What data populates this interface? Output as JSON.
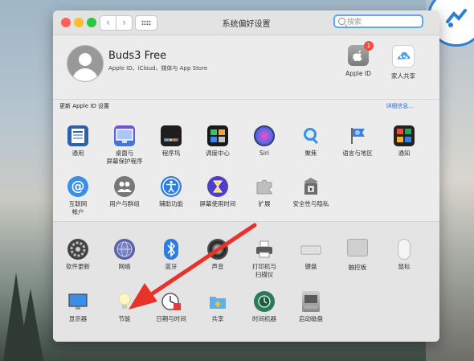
{
  "window": {
    "title": "系统偏好设置",
    "search_placeholder": "搜索",
    "nav_back": "‹",
    "nav_forward": "›"
  },
  "user": {
    "name": "Buds3 Free",
    "subtitle": "Apple ID、iCloud、媒体与 App Store"
  },
  "top_items": [
    {
      "label": "Apple ID",
      "icon": "apple-id-icon",
      "badge": "1"
    },
    {
      "label": "家人共享",
      "icon": "family-sharing-icon"
    }
  ],
  "notice": {
    "text": "更新 Apple ID 设置",
    "link": "详细信息..."
  },
  "row1": [
    {
      "label": "通用",
      "icon": "general-icon"
    },
    {
      "label": "桌面与\n屏幕保护程序",
      "icon": "desktop-icon"
    },
    {
      "label": "程序坞",
      "icon": "dock-icon"
    },
    {
      "label": "调度中心",
      "icon": "mission-control-icon"
    },
    {
      "label": "Siri",
      "icon": "siri-icon"
    },
    {
      "label": "聚焦",
      "icon": "spotlight-icon"
    },
    {
      "label": "语言与地区",
      "icon": "language-icon"
    },
    {
      "label": "通知",
      "icon": "notifications-icon"
    }
  ],
  "row2": [
    {
      "label": "互联网\n帐户",
      "icon": "internet-accounts-icon"
    },
    {
      "label": "用户与群组",
      "icon": "users-icon"
    },
    {
      "label": "辅助功能",
      "icon": "accessibility-icon"
    },
    {
      "label": "屏幕使用时间",
      "icon": "screen-time-icon"
    },
    {
      "label": "扩展",
      "icon": "extensions-icon"
    },
    {
      "label": "安全性与隐私",
      "icon": "security-icon"
    }
  ],
  "row3": [
    {
      "label": "软件更新",
      "icon": "software-update-icon"
    },
    {
      "label": "网络",
      "icon": "network-icon"
    },
    {
      "label": "蓝牙",
      "icon": "bluetooth-icon"
    },
    {
      "label": "声音",
      "icon": "sound-icon"
    },
    {
      "label": "打印机与\n扫描仪",
      "icon": "printer-icon"
    },
    {
      "label": "键盘",
      "icon": "keyboard-icon"
    },
    {
      "label": "触控板",
      "icon": "trackpad-icon"
    },
    {
      "label": "鼠标",
      "icon": "mouse-icon"
    }
  ],
  "row4": [
    {
      "label": "显示器",
      "icon": "display-icon"
    },
    {
      "label": "节能",
      "icon": "energy-saver-icon"
    },
    {
      "label": "日期与时间",
      "icon": "date-time-icon"
    },
    {
      "label": "共享",
      "icon": "sharing-icon"
    },
    {
      "label": "时间机器",
      "icon": "time-machine-icon"
    },
    {
      "label": "启动磁盘",
      "icon": "startup-disk-icon"
    }
  ],
  "colors": {
    "accent": "#2b6fd6",
    "annotation_arrow": "#e8332a"
  }
}
